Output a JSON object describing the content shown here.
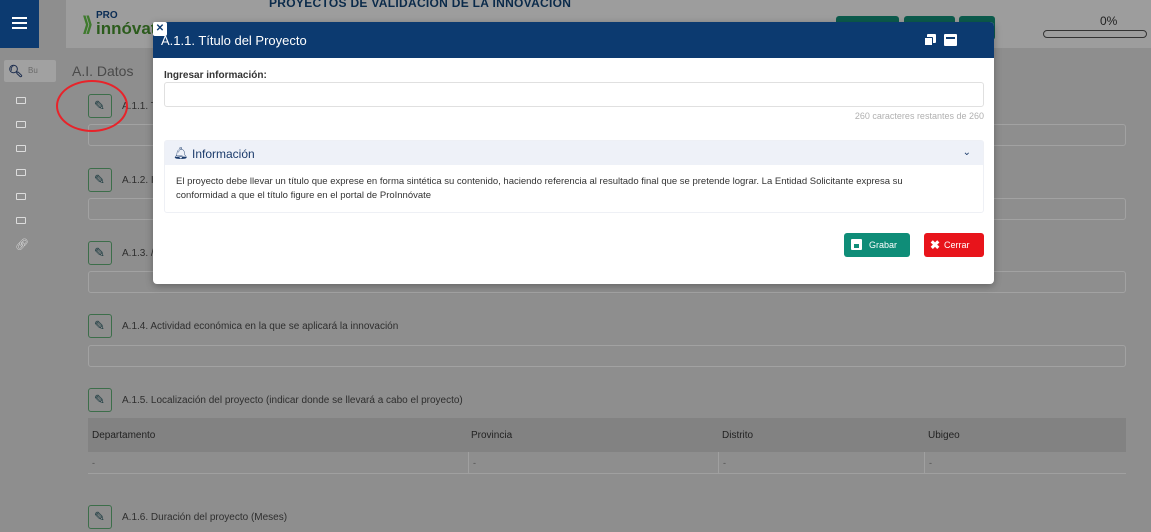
{
  "sidebar": {
    "search_placeholder": "Bu",
    "folders": [
      "folder",
      "folder",
      "folder",
      "folder",
      "folder",
      "folder"
    ],
    "link_icon": "link-icon"
  },
  "header": {
    "logo_top": "PRO",
    "logo_bottom": "innóvat",
    "title": "PROYECTOS DE VALIDACIÓN DE LA INNOVACIÓN",
    "progress": "0%",
    "progress_value": 0
  },
  "main": {
    "section_title": "A.I. Datos",
    "items": [
      {
        "label": "A.1.1. T"
      },
      {
        "label": "A.1.2. I"
      },
      {
        "label": "A.1.3. /"
      },
      {
        "label": "A.1.4. Actividad económica en la que se aplicará la innovación"
      },
      {
        "label": "A.1.5. Localización del proyecto (indicar donde se llevará a cabo el proyecto)"
      },
      {
        "label": "A.1.6. Duración del proyecto (Meses)"
      }
    ],
    "location_table": {
      "columns": [
        "Departamento",
        "Provincia",
        "Distrito",
        "Ubigeo"
      ],
      "row": [
        "-",
        "-",
        "-",
        "-"
      ]
    }
  },
  "modal": {
    "title": "A.1.1. Título del Proyecto",
    "input_label": "Ingresar información:",
    "input_value": "",
    "char_count": "260 caracteres restantes de 260",
    "info_title": "Información",
    "info_text": "El proyecto debe llevar un título que exprese en forma sintética su contenido, haciendo referencia al resultado final que se pretende lograr. La Entidad Solicitante expresa su conformidad a que el título figure en el portal de ProInnóvate",
    "save_label": "Grabar",
    "close_label": "Cerrar"
  },
  "colors": {
    "modal_header": "#0c3a70",
    "save_button": "#0f8d78",
    "close_button": "#e8141b",
    "highlight_circle": "#e8232a"
  }
}
